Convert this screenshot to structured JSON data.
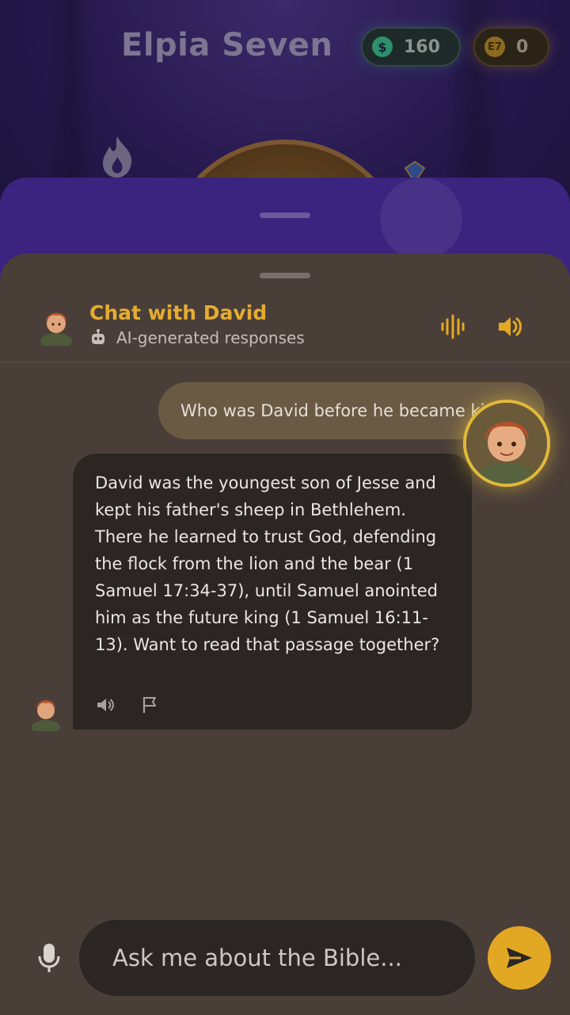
{
  "game": {
    "title": "Elpia Seven",
    "cash_value": "160",
    "coin_value": "0",
    "cash_icon": "dollar-coin-icon",
    "coin_icon": "e7-coin-icon"
  },
  "chat": {
    "title": "Chat with David",
    "subtitle": "AI-generated responses",
    "header_buttons": [
      "audio-wave-icon",
      "speaker-icon"
    ],
    "messages": [
      {
        "role": "user",
        "text": "Who was David before he became king?"
      },
      {
        "role": "assistant",
        "text": "David was the youngest son of Jesse and kept his father's sheep in Bethlehem. There he learned to trust God, defending the flock from the lion and the bear (1 Samuel 17:34-37), until Samuel anointed him as the future king (1 Samuel 16:11-13). Want to read that passage together?",
        "actions": [
          "speaker-icon",
          "flag-icon"
        ]
      }
    ],
    "input_placeholder": "Ask me about the Bible..."
  },
  "colors": {
    "accent": "#e3a823",
    "title_gold": "#e5ad2f",
    "sheet_bg": "#4a3e39",
    "bubble_dark": "#2b2624",
    "user_bubble": "#6a5a44"
  }
}
